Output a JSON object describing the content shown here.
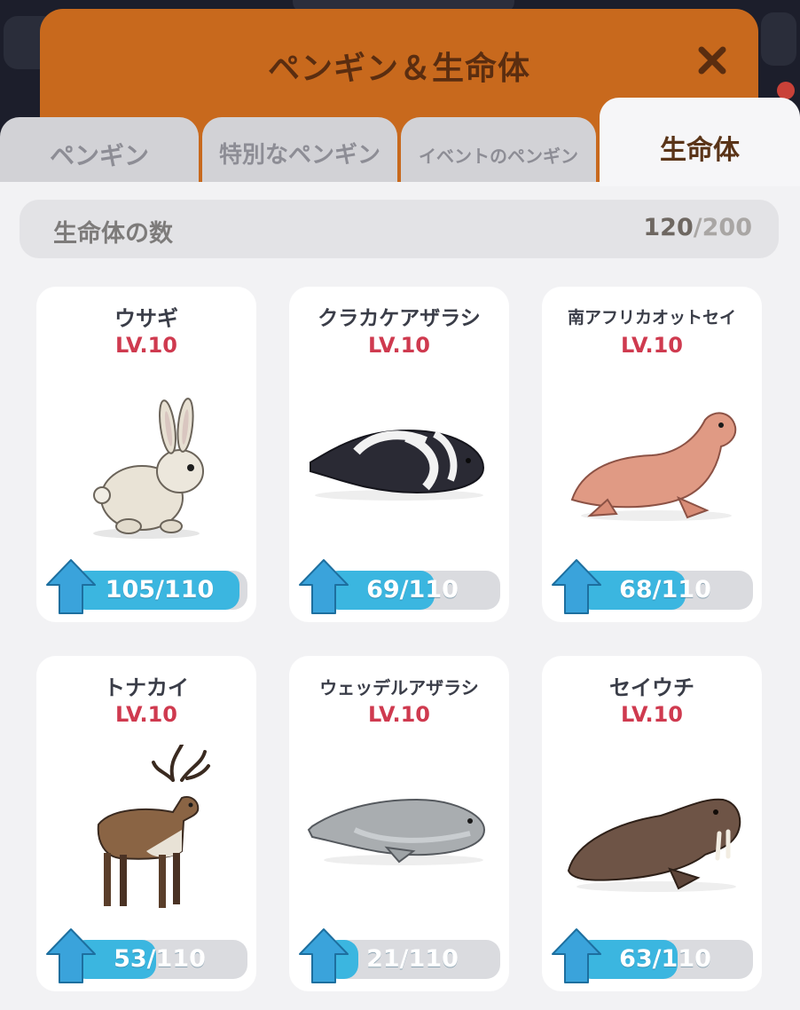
{
  "dialog": {
    "title": "ペンギン＆生命体",
    "close_label": "✕"
  },
  "tabs": [
    {
      "label": "ペンギン",
      "active": false
    },
    {
      "label": "特別なペンギン",
      "active": false
    },
    {
      "label": "イベントのペンギン",
      "active": false
    },
    {
      "label": "生命体",
      "active": true
    }
  ],
  "collection": {
    "label": "生命体の数",
    "current": "120",
    "total": "/200"
  },
  "creatures": [
    {
      "name": "ウサギ",
      "level": "LV.10",
      "progress": "105/110",
      "fraction": 0.955,
      "icon": "rabbit-icon"
    },
    {
      "name": "クラカケアザラシ",
      "level": "LV.10",
      "progress": "69/110",
      "fraction": 0.627,
      "icon": "ribbon-seal-icon"
    },
    {
      "name": "南アフリカオットセイ",
      "level": "LV.10",
      "progress": "68/110",
      "fraction": 0.618,
      "icon": "fur-seal-icon"
    },
    {
      "name": "トナカイ",
      "level": "LV.10",
      "progress": "53/110",
      "fraction": 0.482,
      "icon": "reindeer-icon"
    },
    {
      "name": "ウェッデルアザラシ",
      "level": "LV.10",
      "progress": "21/110",
      "fraction": 0.191,
      "icon": "weddell-seal-icon"
    },
    {
      "name": "セイウチ",
      "level": "LV.10",
      "progress": "63/110",
      "fraction": 0.573,
      "icon": "walrus-icon"
    }
  ],
  "colors": {
    "header": "#c8691d",
    "level_red": "#cf3a4f",
    "progress_blue": "#3bb6e0"
  }
}
